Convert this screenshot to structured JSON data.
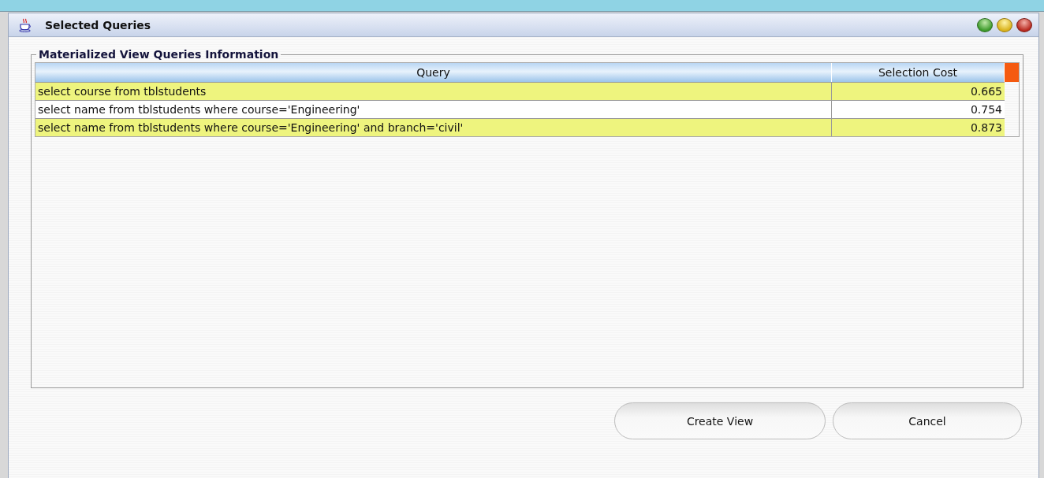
{
  "window": {
    "title": "Selected Queries"
  },
  "group": {
    "title": "Materialized View Queries Information"
  },
  "table": {
    "columns": [
      "Query",
      "Selection Cost"
    ],
    "rows": [
      {
        "query": "select course from tblstudents",
        "cost": "0.665",
        "highlighted": true
      },
      {
        "query": "select name from tblstudents where course='Engineering'",
        "cost": "0.754",
        "highlighted": false
      },
      {
        "query": "select name from tblstudents where course='Engineering' and branch='civil'",
        "cost": "0.873",
        "highlighted": true
      }
    ]
  },
  "buttons": [
    "Create View",
    "Cancel"
  ]
}
